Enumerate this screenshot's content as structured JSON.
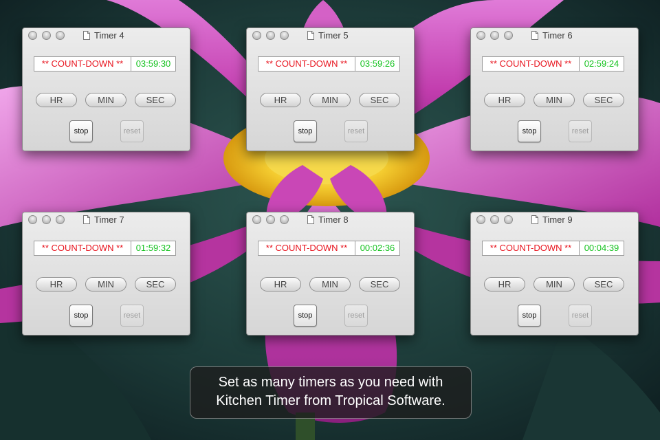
{
  "timers": [
    {
      "title": "Timer 4",
      "mode": "** COUNT-DOWN **",
      "time": "03:59:30",
      "buttons": {
        "hr": "HR",
        "min": "MIN",
        "sec": "SEC",
        "stop": "stop",
        "reset": "reset"
      }
    },
    {
      "title": "Timer 5",
      "mode": "** COUNT-DOWN **",
      "time": "03:59:26",
      "buttons": {
        "hr": "HR",
        "min": "MIN",
        "sec": "SEC",
        "stop": "stop",
        "reset": "reset"
      }
    },
    {
      "title": "Timer 6",
      "mode": "** COUNT-DOWN **",
      "time": "02:59:24",
      "buttons": {
        "hr": "HR",
        "min": "MIN",
        "sec": "SEC",
        "stop": "stop",
        "reset": "reset"
      }
    },
    {
      "title": "Timer 7",
      "mode": "** COUNT-DOWN **",
      "time": "01:59:32",
      "buttons": {
        "hr": "HR",
        "min": "MIN",
        "sec": "SEC",
        "stop": "stop",
        "reset": "reset"
      }
    },
    {
      "title": "Timer 8",
      "mode": "** COUNT-DOWN **",
      "time": "00:02:36",
      "buttons": {
        "hr": "HR",
        "min": "MIN",
        "sec": "SEC",
        "stop": "stop",
        "reset": "reset"
      }
    },
    {
      "title": "Timer 9",
      "mode": "** COUNT-DOWN **",
      "time": "00:04:39",
      "buttons": {
        "hr": "HR",
        "min": "MIN",
        "sec": "SEC",
        "stop": "stop",
        "reset": "reset"
      }
    }
  ],
  "caption": {
    "line1": "Set as many timers as you need with",
    "line2": "Kitchen Timer from Tropical Software."
  },
  "colors": {
    "mode_text": "#e8141e",
    "time_text": "#14c21e",
    "petal": "#c23dae",
    "background": "#1f3b3a"
  },
  "icons": {
    "window_controls": "traffic-light-buttons",
    "title_icon": "document-icon"
  }
}
